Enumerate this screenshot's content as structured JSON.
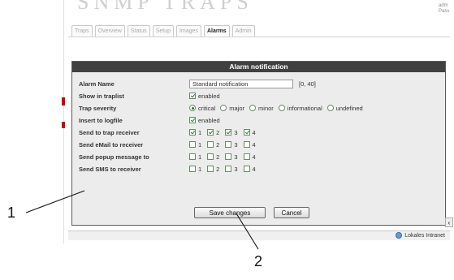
{
  "header": {
    "title": "SNMP TRAPS",
    "right_lines": [
      "adm",
      "Pass"
    ]
  },
  "tabs": [
    {
      "label": "Traps",
      "active": false
    },
    {
      "label": "Overview",
      "active": false
    },
    {
      "label": "Status",
      "active": false
    },
    {
      "label": "Setup",
      "active": false
    },
    {
      "label": "Images",
      "active": false
    },
    {
      "label": "Alarms",
      "active": true
    },
    {
      "label": "Admin",
      "active": false
    }
  ],
  "panel": {
    "title": "Alarm notification",
    "alarm_name": {
      "label": "Alarm Name",
      "value": "Standard notification",
      "hint": "[0, 40]"
    },
    "show_in_traplist": {
      "label": "Show in traplist",
      "checked": true,
      "text": "enabled"
    },
    "trap_severity": {
      "label": "Trap severity",
      "options": [
        {
          "label": "critical",
          "selected": true
        },
        {
          "label": "major",
          "selected": false
        },
        {
          "label": "minor",
          "selected": false
        },
        {
          "label": "informational",
          "selected": false
        },
        {
          "label": "undefined",
          "selected": false
        }
      ]
    },
    "insert_to_logfile": {
      "label": "Insert to logfile",
      "checked": true,
      "text": "enabled"
    },
    "targets": [
      {
        "label": "Send to trap receiver",
        "boxes": [
          {
            "n": "1",
            "checked": true
          },
          {
            "n": "2",
            "checked": true
          },
          {
            "n": "3",
            "checked": true
          },
          {
            "n": "4",
            "checked": true
          }
        ]
      },
      {
        "label": "Send eMail to receiver",
        "boxes": [
          {
            "n": "1",
            "checked": false
          },
          {
            "n": "2",
            "checked": false
          },
          {
            "n": "3",
            "checked": false
          },
          {
            "n": "4",
            "checked": false
          }
        ]
      },
      {
        "label": "Send popup message to",
        "boxes": [
          {
            "n": "1",
            "checked": false
          },
          {
            "n": "2",
            "checked": false
          },
          {
            "n": "3",
            "checked": false
          },
          {
            "n": "4",
            "checked": false
          }
        ]
      },
      {
        "label": "Send SMS to receiver",
        "boxes": [
          {
            "n": "1",
            "checked": false
          },
          {
            "n": "2",
            "checked": false
          },
          {
            "n": "3",
            "checked": false
          },
          {
            "n": "4",
            "checked": false
          }
        ]
      }
    ],
    "save_label": "Save changes",
    "cancel_label": "Cancel"
  },
  "statusbar": {
    "zone": "Lokales Intranet"
  },
  "callouts": [
    "1",
    "2"
  ],
  "colors": {
    "panel_header": "#404040",
    "panel_bg": "#ececec",
    "check": "#2a7a2a"
  }
}
